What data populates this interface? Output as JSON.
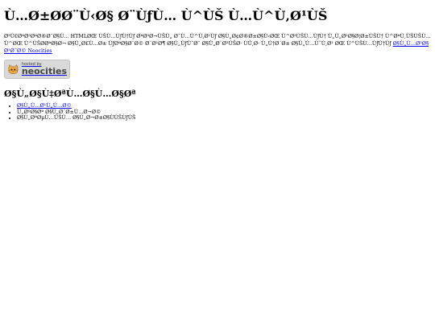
{
  "page": {
    "title": "Ù…Ø±ØØ¨Ù‹Ø§ Ø¨ÙƒÙ… Ù^ÙŠ Ù…Ù^Ù‚Ø¹ÙŠ",
    "intro_text": "Ø³Ù€ØªØ³ØªØ®Ø¯Ø§Ù… HTMLØŒ ÙŠÙ…ÙƒÙ†Ùƒ ØªØ³Ø¬ÙŠÙ„ Ø¯Ù…Ù^Ù‚Ø¹Ùƒ Ø§Ù„Ø¢Ø®Ø±Ø§Ù‹ØŒ Ù^Ø³ÙŠÙ…ÙƒÙ† Ù„Ù„Ø²Ø§Ø¦Ø±ÙŠÙ† Ù^ØªÙ‚ÙŠÙŠÙ… Ù^ØŒ Ù^ÙŠØ­ØªØ§Ø¬ Ø§Ù„Ø£Ù…Ø± ÙƒØªØ§Ø¨Ø© Ø¨Ø¹Ø¶ Ø§Ù„ÙƒÙˆØ¯ Ø§Ù„Ø¨Ø³ÙŠØ· ÙÙ‚Ø· Ù„Ù†Ø´Ø± Ø§Ù„Ù…ÙˆÙ‚Ø¹ ØŒ Ù^ÙŠÙ…ÙƒÙ†Ùƒ",
    "intro_link": "Ø§Ù„Ù…Ø³Ø§Ø¹Ø¯Ø© Neocities"
  },
  "badge": {
    "small_text": "hosted by",
    "brand": "neocities",
    "icon": "neocities-cat-icon"
  },
  "section": {
    "heading": "Ø§Ù„Ø§Ù‡ØªÙ…Ø§Ù…Ø§Øª",
    "items": [
      {
        "label": "Ø§Ù„Ù…Ø¹Ù„Ù…Ø©",
        "is_link": true
      },
      {
        "label": "Ù„ØºØ§Øª Ø§Ù„Ø¨Ø±Ù…Ø¬Ø©",
        "is_link": false
      },
      {
        "label": "Ø§Ù„ØªØµÙ…ÙŠÙ… Ø§Ù„Ø¬Ø±Ø§ÙÙŠÙƒÙŠ",
        "is_link": false
      }
    ]
  }
}
